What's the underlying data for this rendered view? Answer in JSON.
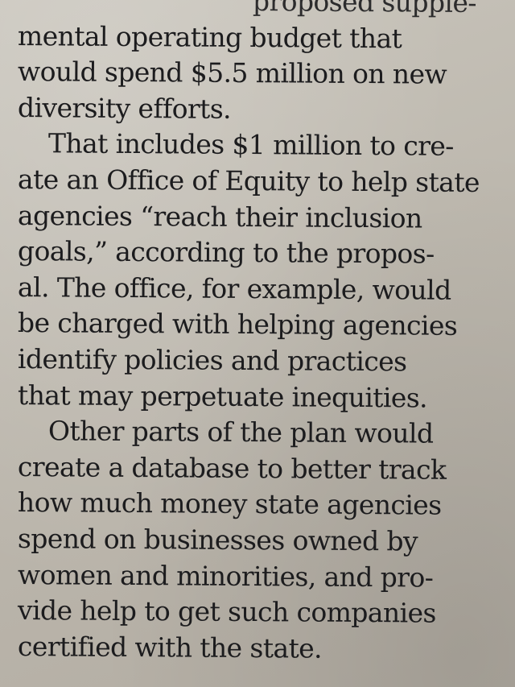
{
  "article": {
    "lines": [
      "proposed supple-",
      "mental operating budget that",
      "would spend $5.5 million on new",
      "diversity efforts.",
      "That includes $1 million to cre-",
      "ate an Office of Equity to help state",
      "agencies “reach their inclusion",
      "goals,” according to the propos-",
      "al. The office, for example, would",
      "be charged with helping agencies",
      "identify policies and practices",
      "that may perpetuate inequities.",
      "Other parts of the plan would",
      "create a database to better track",
      "how much money state agencies",
      "spend on businesses owned by",
      "women and minorities, and pro-",
      "vide help to get such companies",
      "certified with the state."
    ]
  }
}
